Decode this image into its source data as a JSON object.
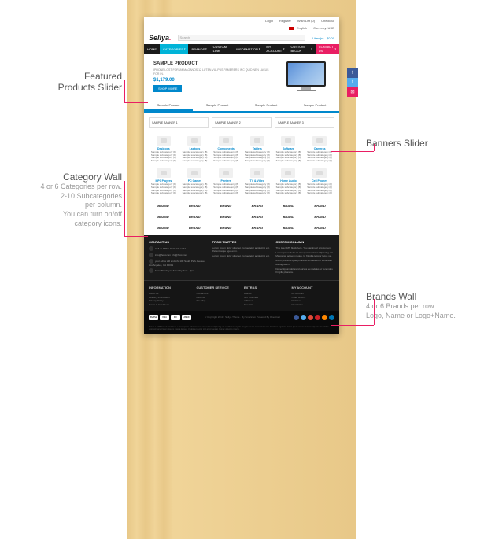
{
  "annotations": {
    "featured": {
      "title": "Featured",
      "subtitle": "Products Slider"
    },
    "banners": {
      "title": "Banners Slider"
    },
    "category": {
      "title": "Category Wall",
      "desc": "4 or 6 Categories per row.\n2-10 Subcategories\nper column.\nYou can turn on/off\ncategory icons."
    },
    "brands": {
      "title": "Brands Wall",
      "desc": "4 or 6 Brands per row.\nLogo, Name or Logo+Name."
    }
  },
  "topbar": {
    "login": "Login",
    "register": "Register",
    "wishlist": "Wish List (0)",
    "checkout": "Checkout",
    "lang": "English",
    "currency": "Currency: USD"
  },
  "logo": "Sellya",
  "search_placeholder": "Search",
  "cart": "0 item(s) - $0.00",
  "nav": [
    "HOME",
    "CATEGORIES",
    "BRANDS",
    "CUSTOM LINK",
    "INFORMATION",
    "MY ACCOUNT",
    "CUSTOM BLOCK",
    "CONTACT US"
  ],
  "featured": {
    "title": "SAMPLE PRODUCT",
    "desc": "IPHONE LOST FORUM MAGANOS 12 LUTEN VULPUS\nPAMBRERS INC QUID NEN LACUS FOR IN.",
    "price": "$1,179.00",
    "button": "SHOP MORE"
  },
  "tabs": [
    "Sample Product",
    "Sample Product",
    "Sample Product",
    "Sample Product"
  ],
  "banners": [
    "SAMPLE BANNER 1",
    "SAMPLE BANNER 2",
    "SAMPLE BANNER 3"
  ],
  "categories_row1": [
    "Desktops",
    "Laptops",
    "Components",
    "Tablets",
    "Software",
    "Cameras"
  ],
  "categories_row2": [
    "MP3 Players",
    "PC Games",
    "Printers",
    "TV & Video",
    "Home Audio",
    "Cell Phones"
  ],
  "cat_sub": "Sample subcategory (8)\nSample subcategory (8)\nSample subcategory (8)\nSample subcategory (8)",
  "brand_label": "BRAND",
  "footer": {
    "contact": {
      "title": "CONTACT US",
      "phone": "Call us FREE\n0123 123 1234",
      "email": "info@host.com\ninfo@host.com",
      "addr": "your adrss\nwill and info\n100 South Park Avenue,\nLos Angeles, CA 90001",
      "hours": "From Monday to\nSaturday 9am - 7pm"
    },
    "twitter": {
      "title": "FROM TWITTER",
      "t1": "Lorem ipsum dolor sit amet, consectetur adipiscing elit. Pellentesque eget enim.",
      "t2": "Lorem ipsum dolor sit amet, consectetur adipiscing elit."
    },
    "custom": {
      "title": "CUSTOM COLUMN",
      "t1": "This is a CMS block here. You can insert any content.",
      "t2": "Lorem ipsum dolor sit amet, consectetur adipiscing elit. Maecenas ac sem neque. Id fringilla tempor lacus vel.",
      "t3": "Morbi pharetra ligula pharetra sit sodales et venenatis dui dignissim.",
      "t4": "Donec Iqsum dolorehd cursus eu sodales et venendos fringilla pharetra."
    }
  },
  "footer_links": {
    "info": {
      "title": "INFORMATION",
      "items": [
        "About Us",
        "Delivery Information",
        "Privacy Policy",
        "Terms & Conditions"
      ]
    },
    "service": {
      "title": "CUSTOMER SERVICE",
      "items": [
        "Contact Us",
        "Returns",
        "Site Map"
      ]
    },
    "extras": {
      "title": "EXTRAS",
      "items": [
        "Brands",
        "Gift Vouchers",
        "Affiliates",
        "Specials"
      ]
    },
    "account": {
      "title": "MY ACCOUNT",
      "items": [
        "My Account",
        "Order History",
        "Wish List",
        "Newsletter"
      ]
    }
  },
  "payments": [
    "PayPal",
    "VISA",
    "MC",
    "AMEX"
  ],
  "copyright": "© Copyright 2013 · Sellya Theme · By Smartcom\nPowered By OpenCart",
  "disclaimer": "This is a CMS based block here. Lorem ipsum dolor sit amet consectetur adipiscing elit vestibulum sagittis fringilla mauris consectetur orci. Curabitur dignissim lorem ipsum massa laoreet vulputate. Curabitur dignissim amet lorem ipsums massa laoreet. Ut aliquet auctor orci at consequat. Donec ut lectus mauris."
}
